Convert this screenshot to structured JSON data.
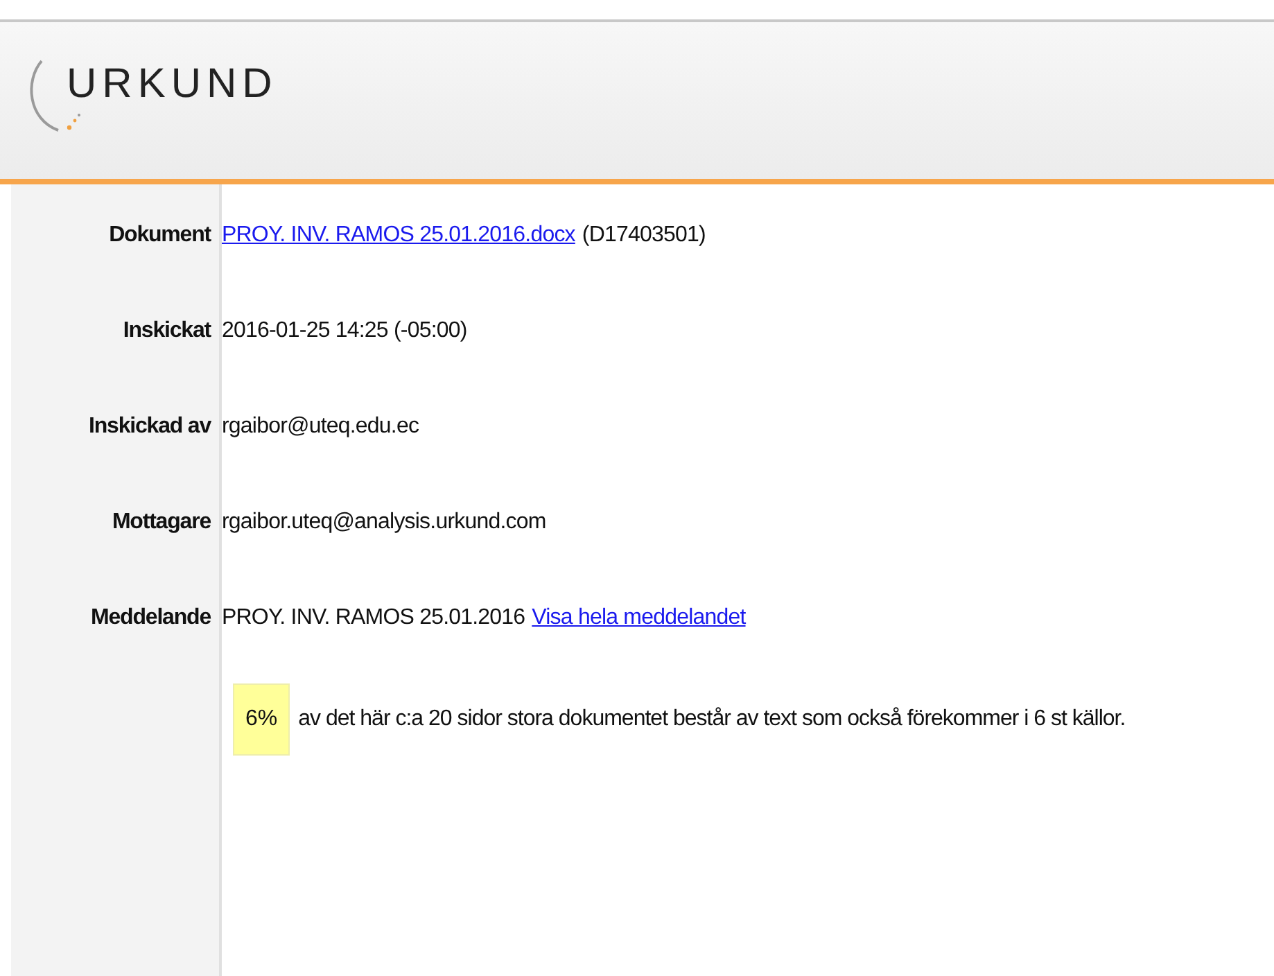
{
  "logo": {
    "text": "URKUND"
  },
  "fields": [
    {
      "label": "Dokument",
      "parts": [
        {
          "kind": "link",
          "text": "PROY. INV. RAMOS 25.01.2016.docx"
        },
        {
          "kind": "text",
          "text": "(D17403501)"
        }
      ]
    },
    {
      "label": "Inskickat",
      "parts": [
        {
          "kind": "text",
          "text": "2016-01-25 14:25 (-05:00)"
        }
      ]
    },
    {
      "label": "Inskickad av",
      "parts": [
        {
          "kind": "text",
          "text": "rgaibor@uteq.edu.ec"
        }
      ]
    },
    {
      "label": "Mottagare",
      "parts": [
        {
          "kind": "text",
          "text": "rgaibor.uteq@analysis.urkund.com"
        }
      ]
    },
    {
      "label": "Meddelande",
      "parts": [
        {
          "kind": "text",
          "text": "PROY. INV. RAMOS 25.01.2016"
        },
        {
          "kind": "link",
          "text": "Visa hela meddelandet"
        }
      ]
    }
  ],
  "summary": {
    "percentage": "6%",
    "text": "av det här c:a 20 sidor stora dokumentet består av text som också förekommer i 6 st källor."
  }
}
